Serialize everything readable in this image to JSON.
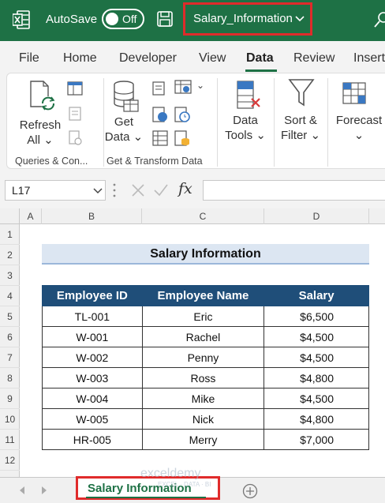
{
  "titlebar": {
    "autosave_label": "AutoSave",
    "autosave_state": "Off",
    "filename": "Salary_Information"
  },
  "tabs": [
    "File",
    "Home",
    "Developer",
    "View",
    "Data",
    "Review",
    "Insert"
  ],
  "active_tab": "Data",
  "ribbon": {
    "refresh_all": [
      "Refresh",
      "All"
    ],
    "get_data": [
      "Get",
      "Data"
    ],
    "data_tools": [
      "Data",
      "Tools"
    ],
    "sort_filter": [
      "Sort &",
      "Filter"
    ],
    "forecast": "Forecast",
    "group_queries": "Queries & Con...",
    "group_transform": "Get & Transform Data"
  },
  "formulabar": {
    "cell_ref": "L17",
    "fx": "fx"
  },
  "columns": [
    "A",
    "B",
    "C",
    "D"
  ],
  "rows": [
    "1",
    "2",
    "3",
    "4",
    "5",
    "6",
    "7",
    "8",
    "9",
    "10",
    "11",
    "12"
  ],
  "sheet": {
    "title": "Salary Information",
    "headers": [
      "Employee ID",
      "Employee Name",
      "Salary"
    ],
    "records": [
      [
        "TL-001",
        "Eric",
        "$6,500"
      ],
      [
        "W-001",
        "Rachel",
        "$4,500"
      ],
      [
        "W-002",
        "Penny",
        "$4,500"
      ],
      [
        "W-003",
        "Ross",
        "$4,800"
      ],
      [
        "W-004",
        "Mike",
        "$4,500"
      ],
      [
        "W-005",
        "Nick",
        "$4,800"
      ],
      [
        "HR-005",
        "Merry",
        "$7,000"
      ]
    ]
  },
  "sheet_tabs": [
    "Salary Information"
  ],
  "watermark": {
    "name": "exceldemy",
    "tagline": "EXCEL · DATA · BI"
  },
  "colors": {
    "excel_green": "#1e7145",
    "header_navy": "#1f4e79",
    "title_fill": "#dce6f2",
    "highlight_red": "#e02b2b"
  }
}
